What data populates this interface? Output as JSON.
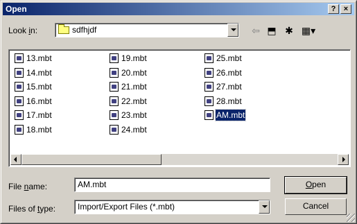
{
  "window": {
    "title": "Open",
    "help_label": "?",
    "close_label": "×"
  },
  "lookin": {
    "label_pre": "Look ",
    "label_key": "i",
    "label_post": "n:",
    "value": "sdfhjdf"
  },
  "toolbar": {
    "back_glyph": "⇦",
    "up_glyph": "⬒",
    "newfolder_glyph": "✱",
    "view_glyph": "▦▾"
  },
  "files": [
    {
      "name": "13.mbt"
    },
    {
      "name": "14.mbt"
    },
    {
      "name": "15.mbt"
    },
    {
      "name": "16.mbt"
    },
    {
      "name": "17.mbt"
    },
    {
      "name": "18.mbt"
    },
    {
      "name": "19.mbt"
    },
    {
      "name": "20.mbt"
    },
    {
      "name": "21.mbt"
    },
    {
      "name": "22.mbt"
    },
    {
      "name": "23.mbt"
    },
    {
      "name": "24.mbt"
    },
    {
      "name": "25.mbt"
    },
    {
      "name": "26.mbt"
    },
    {
      "name": "27.mbt"
    },
    {
      "name": "28.mbt"
    },
    {
      "name": "AM.mbt",
      "selected": true
    }
  ],
  "filename": {
    "label_pre": "File ",
    "label_key": "n",
    "label_post": "ame:",
    "value": "AM.mbt"
  },
  "filetype": {
    "label_pre": "Files of ",
    "label_key": "t",
    "label_post": "ype:",
    "value": "Import/Export Files (*.mbt)"
  },
  "buttons": {
    "open_key": "O",
    "open_rest": "pen",
    "cancel": "Cancel"
  },
  "colors": {
    "titlebar": "#0a246a",
    "selection": "#0a246a",
    "face": "#d4d0c8"
  }
}
